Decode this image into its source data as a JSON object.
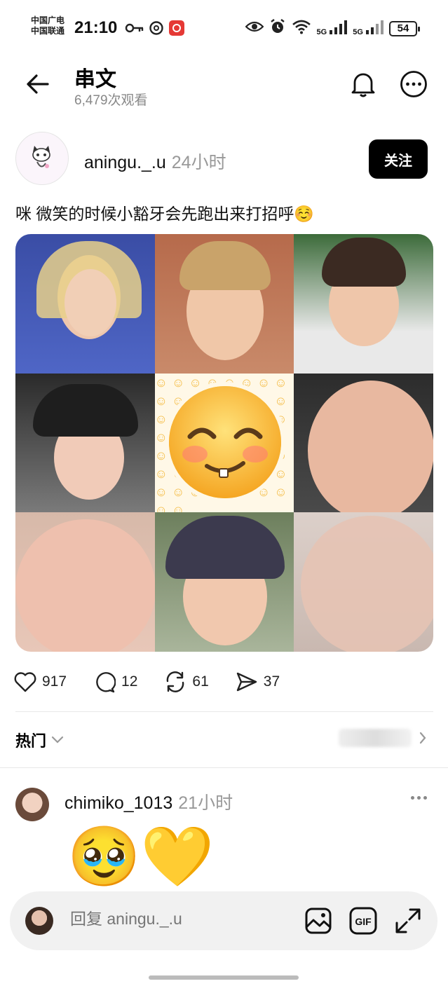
{
  "status_bar": {
    "carrier1": "中国广电",
    "carrier2": "中国联通",
    "time": "21:10",
    "network1": "5G",
    "network2": "5G",
    "battery": "54"
  },
  "header": {
    "title": "串文",
    "views": "6,479次观看"
  },
  "post": {
    "author": "aningu._.u",
    "time": "24小时",
    "follow_label": "关注",
    "text": "咪 微笑的时候小豁牙会先跑出来打招呼☺️",
    "center_emoji": "☺️",
    "likes": "917",
    "comments": "12",
    "reposts": "61",
    "shares": "37"
  },
  "sort": {
    "label": "热门"
  },
  "comment": {
    "author": "chimiko_1013",
    "time": "21小时",
    "emoji": "🥹💛"
  },
  "reply": {
    "placeholder": "回复 aningu._.u",
    "gif_label": "GIF"
  }
}
